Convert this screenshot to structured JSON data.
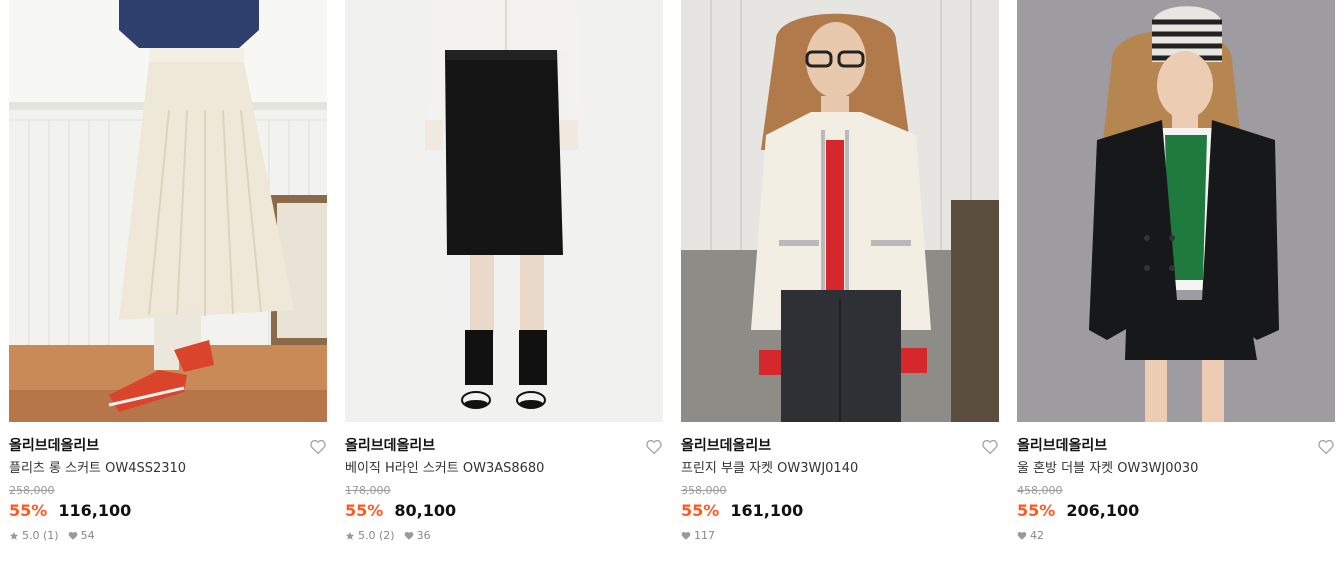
{
  "products": [
    {
      "brand": "올리브데올리브",
      "name": "플리츠 롱 스커트 OW4SS2310",
      "original_price": "258,000",
      "discount": "55%",
      "price": "116,100",
      "rating": "5.0",
      "reviews": "(1)",
      "likes": "54",
      "image_icon": "pleated-long-skirt-photo"
    },
    {
      "brand": "올리브데올리브",
      "name": "베이직 H라인 스커트 OW3AS8680",
      "original_price": "178,000",
      "discount": "55%",
      "price": "80,100",
      "rating": "5.0",
      "reviews": "(2)",
      "likes": "36",
      "image_icon": "h-line-skirt-photo"
    },
    {
      "brand": "올리브데올리브",
      "name": "프린지 부클 자켓 OW3WJ0140",
      "original_price": "358,000",
      "discount": "55%",
      "price": "161,100",
      "rating": "",
      "reviews": "",
      "likes": "117",
      "image_icon": "boucle-jacket-photo"
    },
    {
      "brand": "올리브데올리브",
      "name": "울 혼방 더블 자켓 OW3WJ0030",
      "original_price": "458,000",
      "discount": "55%",
      "price": "206,100",
      "rating": "",
      "reviews": "",
      "likes": "42",
      "image_icon": "double-jacket-photo"
    }
  ],
  "colors": {
    "discount": "#ff5a1f",
    "original_price": "#9b9b9b",
    "stats": "#888888"
  }
}
